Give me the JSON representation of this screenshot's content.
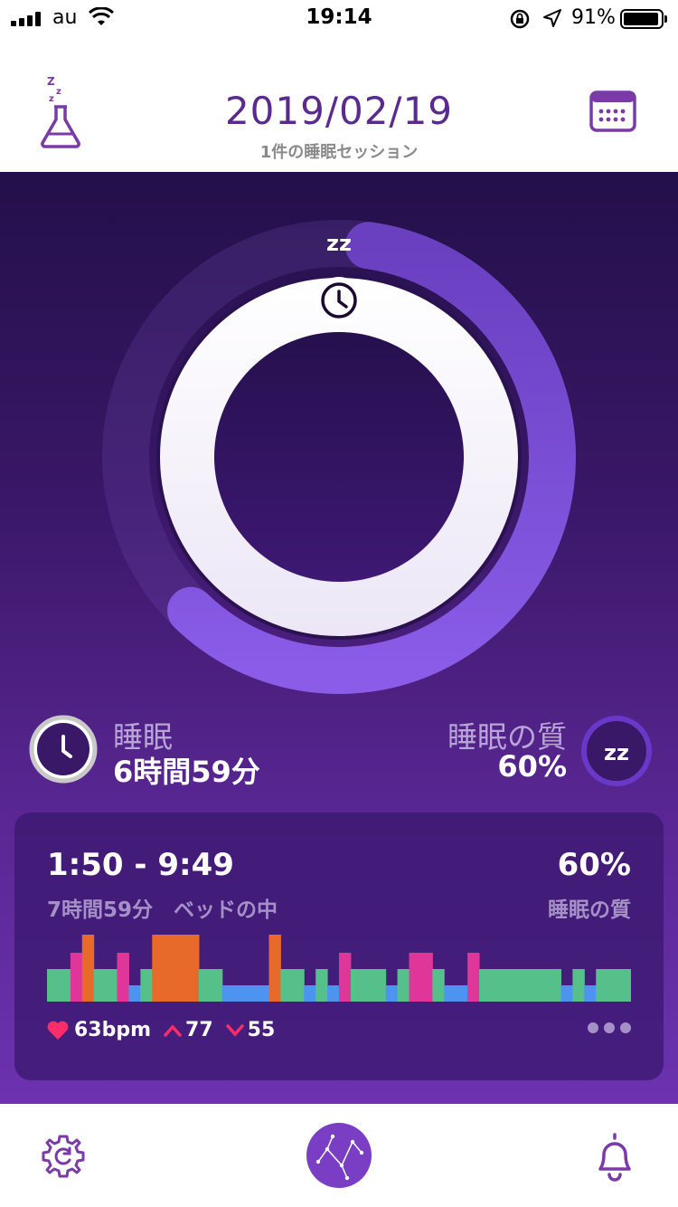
{
  "status_bar": {
    "carrier": "au",
    "time": "19:14",
    "battery": "91%",
    "battery_level": 0.91
  },
  "header": {
    "date": "2019/02/19",
    "sessions": "1件の睡眠セッション"
  },
  "ring": {
    "zz_label": "zz",
    "sleep_fraction": 0.6
  },
  "stats": {
    "sleep_label": "睡眠",
    "sleep_value": "6時間59分",
    "quality_label": "睡眠の質",
    "quality_value": "60%"
  },
  "card": {
    "time_range": "1:50 - 9:49",
    "duration": "7時間59分　ベッドの中",
    "quality_pct": "60%",
    "quality_label": "睡眠の質",
    "hypnogram": [
      {
        "stage": "light",
        "w": 2
      },
      {
        "stage": "awake",
        "w": 1
      },
      {
        "stage": "rem",
        "w": 1
      },
      {
        "stage": "light",
        "w": 2
      },
      {
        "stage": "awake",
        "w": 1
      },
      {
        "stage": "deep",
        "w": 1
      },
      {
        "stage": "light",
        "w": 1
      },
      {
        "stage": "rem",
        "w": 2
      },
      {
        "stage": "rem",
        "w": 2
      },
      {
        "stage": "light",
        "w": 2
      },
      {
        "stage": "deep",
        "w": 4
      },
      {
        "stage": "rem",
        "w": 1
      },
      {
        "stage": "light",
        "w": 2
      },
      {
        "stage": "deep",
        "w": 1
      },
      {
        "stage": "light",
        "w": 1
      },
      {
        "stage": "deep",
        "w": 1
      },
      {
        "stage": "awake",
        "w": 1
      },
      {
        "stage": "light",
        "w": 3
      },
      {
        "stage": "deep",
        "w": 1
      },
      {
        "stage": "light",
        "w": 1
      },
      {
        "stage": "awake",
        "w": 2
      },
      {
        "stage": "light",
        "w": 1
      },
      {
        "stage": "deep",
        "w": 2
      },
      {
        "stage": "awake",
        "w": 1
      },
      {
        "stage": "light",
        "w": 7
      },
      {
        "stage": "deep",
        "w": 1
      },
      {
        "stage": "light",
        "w": 1
      },
      {
        "stage": "deep",
        "w": 1
      },
      {
        "stage": "light",
        "w": 3
      }
    ],
    "hr_avg": "63bpm",
    "hr_max": "77",
    "hr_min": "55"
  },
  "colors": {
    "accent": "#5a2a8c",
    "deep": "#4d94f0",
    "light": "#55c08a",
    "rem": "#e86a2a",
    "awake": "#e0369a",
    "heart": "#ff2d6a"
  },
  "icons": {
    "lab": "flask-zzz-icon",
    "calendar": "calendar-icon",
    "clock": "clock-icon",
    "zz": "zz-icon",
    "settings": "gear-icon",
    "home": "constellation-icon",
    "bell": "bell-icon"
  }
}
